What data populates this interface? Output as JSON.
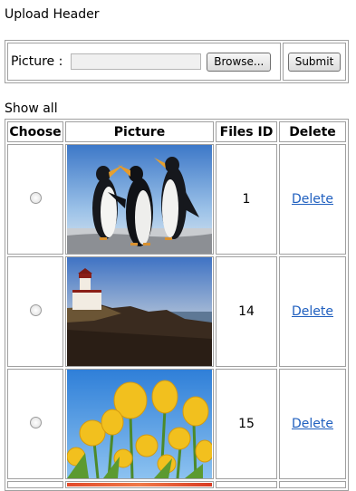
{
  "page": {
    "title": "Upload Header",
    "show_all": "Show all"
  },
  "upload": {
    "picture_label": "Picture :",
    "browse_label": "Browse...",
    "submit_label": "Submit"
  },
  "table": {
    "headers": [
      "Choose",
      "Picture",
      "Files ID",
      "Delete"
    ],
    "rows": [
      {
        "file_id": "1",
        "delete_label": "Delete",
        "image": "penguins-photo"
      },
      {
        "file_id": "14",
        "delete_label": "Delete",
        "image": "lighthouse-photo"
      },
      {
        "file_id": "15",
        "delete_label": "Delete",
        "image": "tulips-photo"
      }
    ]
  }
}
